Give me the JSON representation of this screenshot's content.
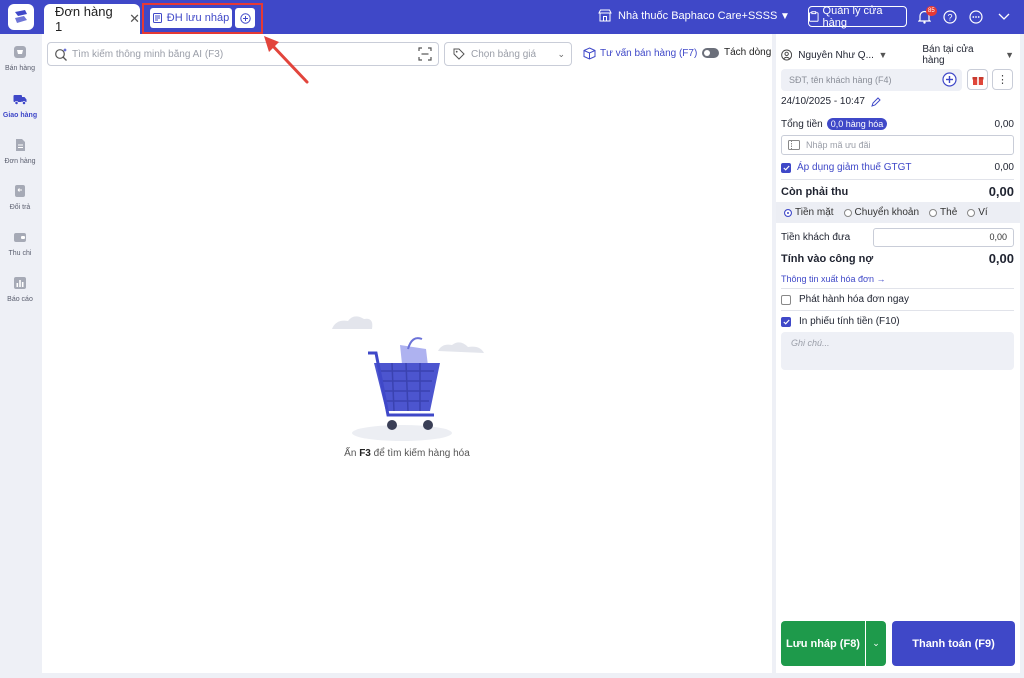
{
  "colors": {
    "brand": "#3f48c8",
    "highlight": "#e53935",
    "save": "#1e9a4b"
  },
  "header": {
    "tab_label": "Đơn hàng 1",
    "tab_close": "✕",
    "draft_label": "ĐH lưu nháp",
    "store_name": "Nhà thuốc Baphaco Care+SSSS",
    "manage_label": "Quản lý cửa hàng",
    "notification_count": "85",
    "icons": [
      "logo-icon",
      "store-icon",
      "bell-icon",
      "help-icon",
      "more-icon",
      "chevron-down-icon"
    ]
  },
  "sidebar": {
    "items": [
      {
        "label": "Bán hàng",
        "icon": "cart-icon",
        "active": false
      },
      {
        "label": "Giao hàng",
        "icon": "truck-icon",
        "active": true
      },
      {
        "label": "Đơn hàng",
        "icon": "document-icon",
        "active": false
      },
      {
        "label": "Đổi trả",
        "icon": "return-icon",
        "active": false
      },
      {
        "label": "Thu chi",
        "icon": "wallet-icon",
        "active": false
      },
      {
        "label": "Báo cáo",
        "icon": "chart-icon",
        "active": false
      }
    ]
  },
  "main": {
    "search_placeholder": "Tìm kiếm thông minh bằng AI (F3)",
    "price_placeholder": "Chọn bảng giá",
    "consult_label": "Tư vấn bán hàng (F7)",
    "split_label": "Tách dòng",
    "split_on": false,
    "empty_prefix": "Ấn ",
    "empty_key": "F3",
    "empty_suffix": " để tìm kiếm hàng hóa"
  },
  "order": {
    "staff": "Nguyễn Như Q...",
    "sale_type": "Bán tại cửa hàng",
    "customer_placeholder": "SĐT, tên khách hàng (F4)",
    "datetime": "24/10/2025 - 10:47",
    "total_label": "Tổng tiền",
    "item_count": "0,0 hàng hóa",
    "total_value": "0,00",
    "discount_placeholder": "Nhập mã ưu đãi",
    "vat_label": "Áp dụng giảm thuế GTGT",
    "vat_value": "0,00",
    "vat_checked": true,
    "due_label": "Còn phải thu",
    "due_value": "0,00",
    "payment_methods": [
      {
        "label": "Tiền mặt",
        "selected": true
      },
      {
        "label": "Chuyển khoản",
        "selected": false
      },
      {
        "label": "Thẻ",
        "selected": false
      },
      {
        "label": "Ví",
        "selected": false
      }
    ],
    "cash_label": "Tiền khách đưa",
    "cash_value": "0,00",
    "debt_label": "Tính vào công nợ",
    "debt_value": "0,00",
    "invoice_link": "Thông tin xuất hóa đơn →",
    "issue_invoice_label": "Phát hành hóa đơn ngay",
    "issue_invoice_checked": false,
    "print_label": "In phiếu tính tiền (F10)",
    "print_checked": true,
    "note_placeholder": "Ghi chú...",
    "save_label": "Lưu nháp (F8)",
    "pay_label": "Thanh toán (F9)"
  }
}
